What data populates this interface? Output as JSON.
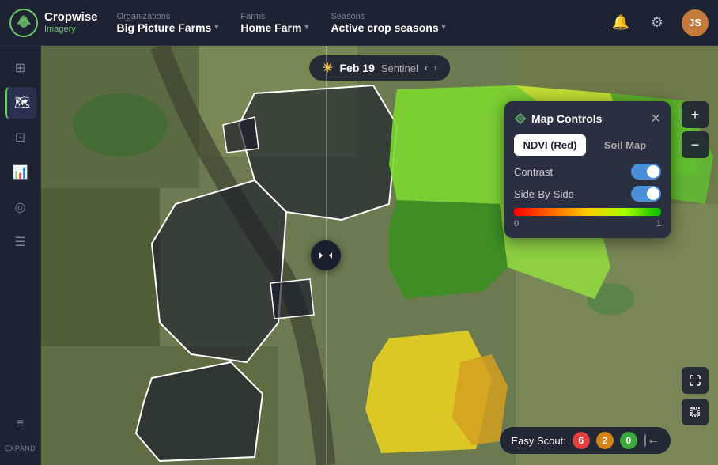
{
  "topnav": {
    "logo_name": "Cropwise",
    "logo_sub": "Imagery",
    "org_label": "Organizations",
    "org_value": "Big Picture Farms",
    "farm_label": "Farms",
    "farm_value": "Home Farm",
    "season_label": "Seasons",
    "season_value": "Active crop seasons",
    "user_initials": "JS"
  },
  "sidebar": {
    "items": [
      {
        "icon": "⊞",
        "name": "grid-icon"
      },
      {
        "icon": "🗺",
        "name": "map-icon"
      },
      {
        "icon": "⊡",
        "name": "layers-icon"
      },
      {
        "icon": "📊",
        "name": "chart-icon"
      },
      {
        "icon": "📍",
        "name": "pin-icon"
      },
      {
        "icon": "📋",
        "name": "report-icon"
      }
    ],
    "expand_label": "EXPAND",
    "menu_icon": "≡"
  },
  "datebar": {
    "date": "Feb 19",
    "source": "Sentinel"
  },
  "map_controls": {
    "title": "Map Controls",
    "tab_ndvi": "NDVI (Red)",
    "tab_soil": "Soil Map",
    "contrast_label": "Contrast",
    "side_by_side_label": "Side-By-Side",
    "ndvi_min": "0",
    "ndvi_max": "1",
    "close_icon": "✕",
    "settings_icon": "⚙"
  },
  "easy_scout": {
    "label": "Easy Scout:",
    "badge_red": "6",
    "badge_orange": "2",
    "badge_green": "0"
  },
  "zoom": {
    "plus": "+",
    "minus": "−"
  }
}
